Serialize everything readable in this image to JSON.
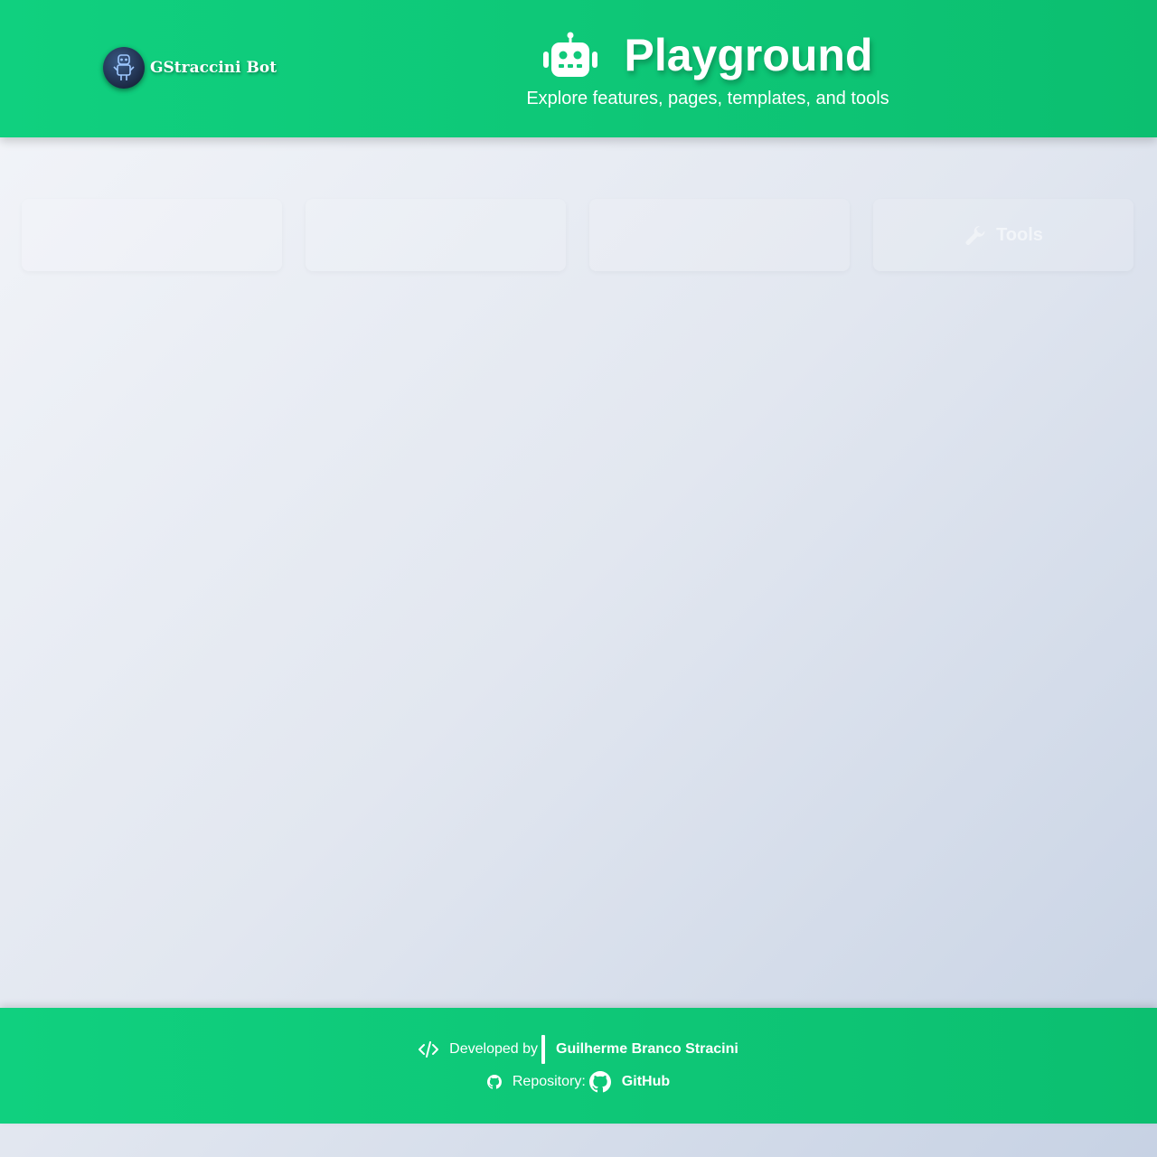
{
  "header": {
    "brand_name": "GStraccini Bot",
    "title": "Playground",
    "subtitle": "Explore features, pages, templates, and tools"
  },
  "footer": {
    "developed_by_label": "Developed by",
    "author": "Guilherme Branco Stracini",
    "repository_label": "Repository:",
    "repository_link": "GitHub"
  },
  "columns": [
    {
      "label": "",
      "items": [
        "",
        "",
        "",
        "",
        "",
        ""
      ]
    },
    {
      "label": "",
      "items": [
        "",
        "",
        "",
        "",
        "",
        "",
        "",
        "",
        "",
        "",
        "",
        ""
      ]
    },
    {
      "label": "",
      "items": [
        "",
        "",
        "",
        "",
        "",
        "",
        "",
        ""
      ]
    },
    {
      "label": "Tools",
      "items": [
        "",
        "",
        "",
        ""
      ]
    }
  ],
  "colors": {
    "accent": "#10d07f",
    "accent_dark": "#0cbf70",
    "page_bg_start": "#f3f5f9",
    "page_bg_end": "#c7d2e4",
    "text_on_accent": "#ffffff"
  },
  "icons": {
    "hero": "robot-icon",
    "brand": "robot-avatar-icon",
    "developer": "code-icon",
    "repository": "github-icon",
    "repository_link": "github-icon",
    "tools": "wrench-icon"
  }
}
